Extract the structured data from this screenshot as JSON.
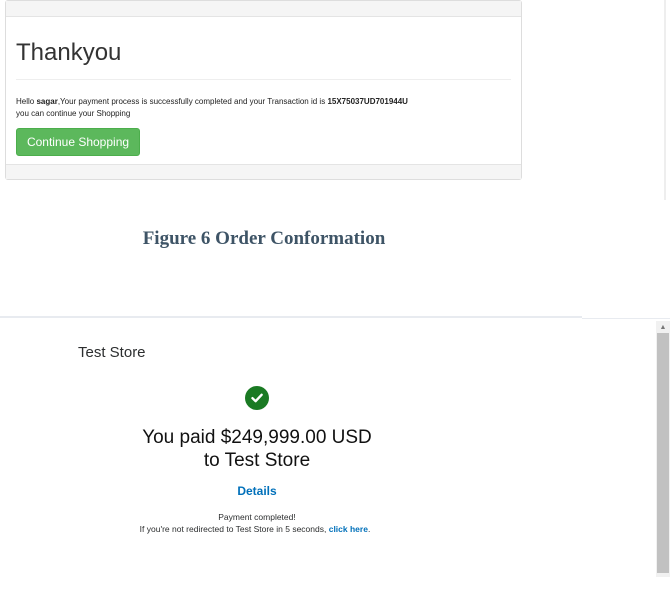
{
  "thankyou": {
    "title": "Thankyou",
    "greeting_prefix": "Hello ",
    "user_name": "sagar",
    "message_mid": ",Your payment process is successfully completed and your Transaction id is ",
    "transaction_id": "15X75037UD701944U",
    "message_line2": "you can continue your Shopping",
    "continue_label": "Continue Shopping",
    "button_color": "#5cb85c"
  },
  "caption": "Figure 6 Order Conformation",
  "paypal": {
    "store_name": "Test Store",
    "success_icon": "check-circle-icon",
    "paid_line1": "You paid $249,999.00 USD",
    "paid_line2": "to Test Store",
    "details_label": "Details",
    "payment_completed": "Payment completed!",
    "redirect_text": "If you're not redirected to Test Store in 5 seconds, ",
    "click_here_label": "click here",
    "redirect_end": ".",
    "link_color": "#0070ba",
    "success_color": "#1a7a23"
  }
}
